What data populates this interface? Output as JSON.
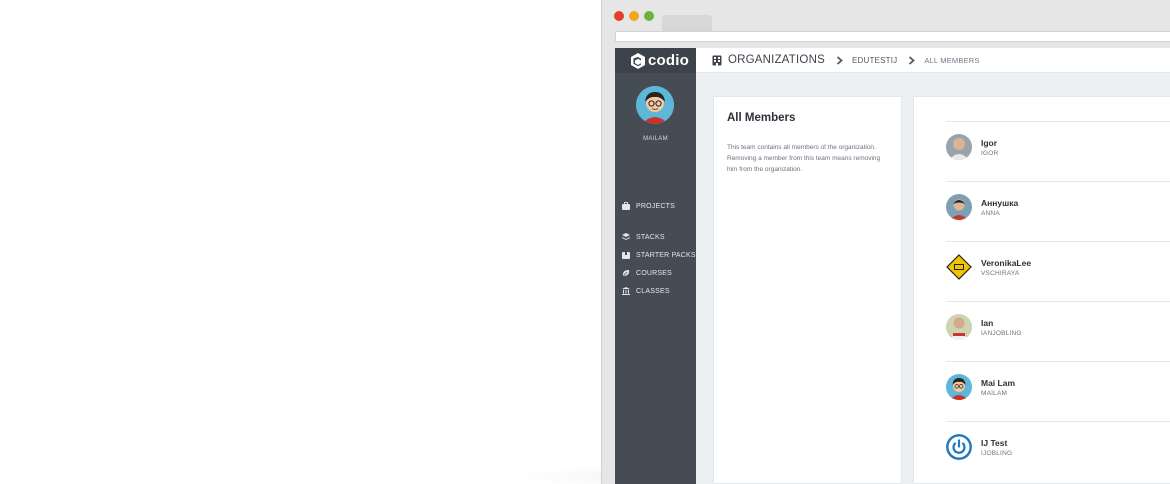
{
  "app": {
    "logo_text": "codio"
  },
  "sidebar": {
    "username": "MAILAM",
    "items": [
      {
        "label": "PROJECTS",
        "icon": "briefcase-icon"
      },
      {
        "label": "STACKS",
        "icon": "layers-icon"
      },
      {
        "label": "STARTER PACKS",
        "icon": "box-icon"
      },
      {
        "label": "COURSES",
        "icon": "leaf-icon"
      },
      {
        "label": "CLASSES",
        "icon": "bank-icon"
      }
    ]
  },
  "breadcrumb": {
    "section": "ORGANIZATIONS",
    "organization": "EDUTESTIJ",
    "current": "ALL MEMBERS"
  },
  "team": {
    "title": "All Members",
    "description": "This team contains all members of the organization. Removing a member from this team means removing him from the organization."
  },
  "members": [
    {
      "name": "Igor",
      "username": "IGOR"
    },
    {
      "name": "Аннушка",
      "username": "ANNA"
    },
    {
      "name": "VeronikaLee",
      "username": "VSCHIRAYA"
    },
    {
      "name": "Ian",
      "username": "IANJOBLING"
    },
    {
      "name": "Mai Lam",
      "username": "MAILAM"
    },
    {
      "name": "IJ Test",
      "username": "IJOBLING"
    }
  ],
  "colors": {
    "sidebar_bg": "#464c54",
    "content_bg": "#edf0f3",
    "window_red": "#e23f2f",
    "window_yellow": "#f1a522",
    "window_green": "#6cb33e"
  }
}
